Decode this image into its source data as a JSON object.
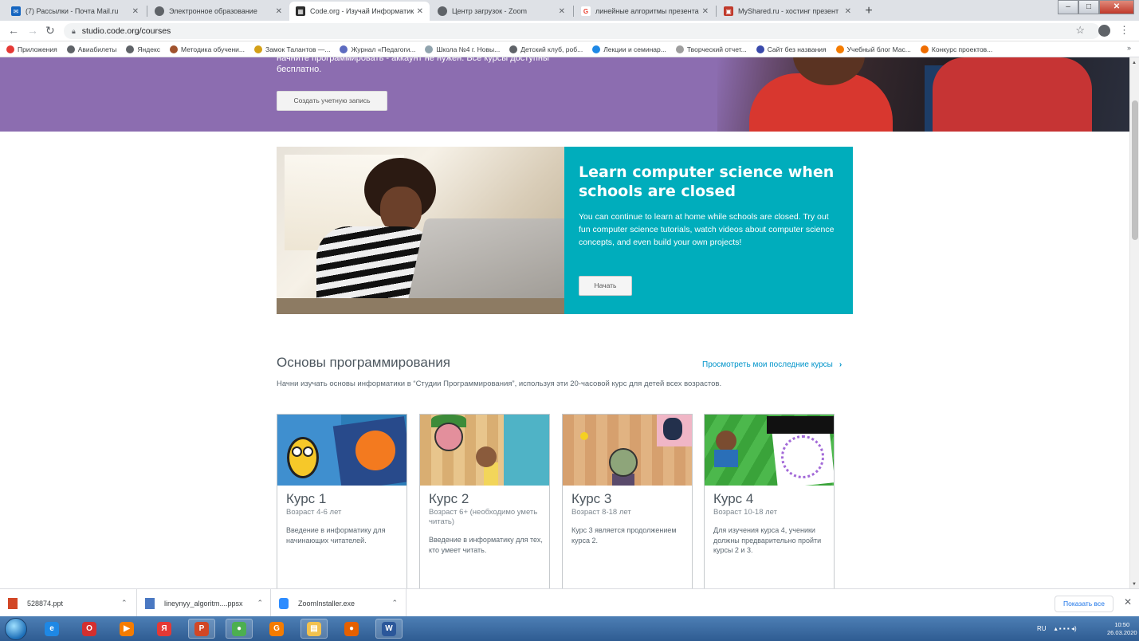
{
  "browser": {
    "tabs": [
      {
        "title": "(7) Рассылки - Почта Mail.ru",
        "icon": "mail-icon",
        "color": "#1565c0",
        "active": false
      },
      {
        "title": "Электронное образование",
        "icon": "globe-icon",
        "color": "#5f6368",
        "active": false
      },
      {
        "title": "Code.org - Изучай Информатик",
        "icon": "codeorg-icon",
        "color": "#2b2b2b",
        "active": true
      },
      {
        "title": "Центр загрузок - Zoom",
        "icon": "globe-icon",
        "color": "#5f6368",
        "active": false
      },
      {
        "title": "линейные алгоритмы презента",
        "icon": "google-icon",
        "color": "#ea4335",
        "active": false
      },
      {
        "title": "MyShared.ru - хостинг презент",
        "icon": "myshared-icon",
        "color": "#c0392b",
        "active": false
      }
    ],
    "new_tab": "+",
    "url": "studio.code.org/courses",
    "bookmarks": [
      {
        "label": "Приложения",
        "color": "#e53935"
      },
      {
        "label": "Авиабилеты",
        "color": "#5f6368"
      },
      {
        "label": "Яндекс",
        "color": "#5f6368"
      },
      {
        "label": "Методика обучени...",
        "color": "#a0522d"
      },
      {
        "label": "Замок Талантов —...",
        "color": "#d4a017"
      },
      {
        "label": "Журнал «Педагоги...",
        "color": "#5c6bc0"
      },
      {
        "label": "Школа №4 г. Новы...",
        "color": "#90a4ae"
      },
      {
        "label": "Детский клуб, роб...",
        "color": "#5f6368"
      },
      {
        "label": "Лекции и семинар...",
        "color": "#1e88e5"
      },
      {
        "label": "Творческий отчет...",
        "color": "#9e9e9e"
      },
      {
        "label": "Сайт без названия",
        "color": "#3949ab"
      },
      {
        "label": "Учебный блог Мас...",
        "color": "#f57c00"
      },
      {
        "label": "Конкурс проектов...",
        "color": "#ef6c00"
      }
    ],
    "bookmarks_more": "»"
  },
  "hero": {
    "text_partial": "начните программировать - аккаунт не нужен. Все курсы доступны бесплатно.",
    "button": "Создать учетную запись"
  },
  "banner": {
    "title": "Learn computer science when schools are closed",
    "body": "You can continue to learn at home while schools are closed. Try out fun computer science tutorials, watch videos about computer science concepts, and even build your own projects!",
    "button": "Начать"
  },
  "section": {
    "title": "Основы программирования",
    "link": "Просмотреть мои последние курсы",
    "link_chevron": "›",
    "description": "Начни изучать основы информатики в “Студии Программирования”, используя эти 20-часовой курс для детей всех возрастов."
  },
  "courses": [
    {
      "title": "Курс 1",
      "age": "Возраст 4-6 лет",
      "description": "Введение в информатику для начинающих читателей."
    },
    {
      "title": "Курс 2",
      "age": "Возраст 6+ (необходимо уметь читать)",
      "description": "Введение в информатику для тех, кто умеет читать."
    },
    {
      "title": "Курс 3",
      "age": "Возраст 8-18 лет",
      "description": "Курс 3 является продолжением курса 2."
    },
    {
      "title": "Курс 4",
      "age": "Возраст 10-18 лет",
      "description": "Для изучения курса 4, ученики должны предварительно пройти курсы 2 и 3."
    }
  ],
  "downloads": [
    {
      "name": "528874.ppt",
      "icon": "ppt-icon"
    },
    {
      "name": "lineynyy_algoritm....ppsx",
      "icon": "ppsx-icon"
    },
    {
      "name": "ZoomInstaller.exe",
      "icon": "zoom-icon"
    }
  ],
  "shelf": {
    "show_all": "Показать все",
    "close": "✕"
  },
  "taskbar": {
    "apps": [
      {
        "name": "ie-icon",
        "glyph": "e",
        "color": "#1e88e5"
      },
      {
        "name": "opera-icon",
        "glyph": "O",
        "color": "#d32f2f"
      },
      {
        "name": "media-icon",
        "glyph": "▶",
        "color": "#f57c00"
      },
      {
        "name": "yandex-icon",
        "glyph": "Я",
        "color": "#e53935"
      },
      {
        "name": "powerpoint-icon",
        "glyph": "P",
        "color": "#d24726"
      },
      {
        "name": "chrome-icon",
        "glyph": "●",
        "color": "#4caf50"
      },
      {
        "name": "pdf-icon",
        "glyph": "G",
        "color": "#f57c00"
      },
      {
        "name": "folder-icon",
        "glyph": "▤",
        "color": "#f2c14e"
      },
      {
        "name": "firefox-icon",
        "glyph": "●",
        "color": "#e66000"
      },
      {
        "name": "word-icon",
        "glyph": "W",
        "color": "#2b579a"
      }
    ],
    "lang": "RU",
    "time": "10:50",
    "date": "26.03.2020"
  }
}
